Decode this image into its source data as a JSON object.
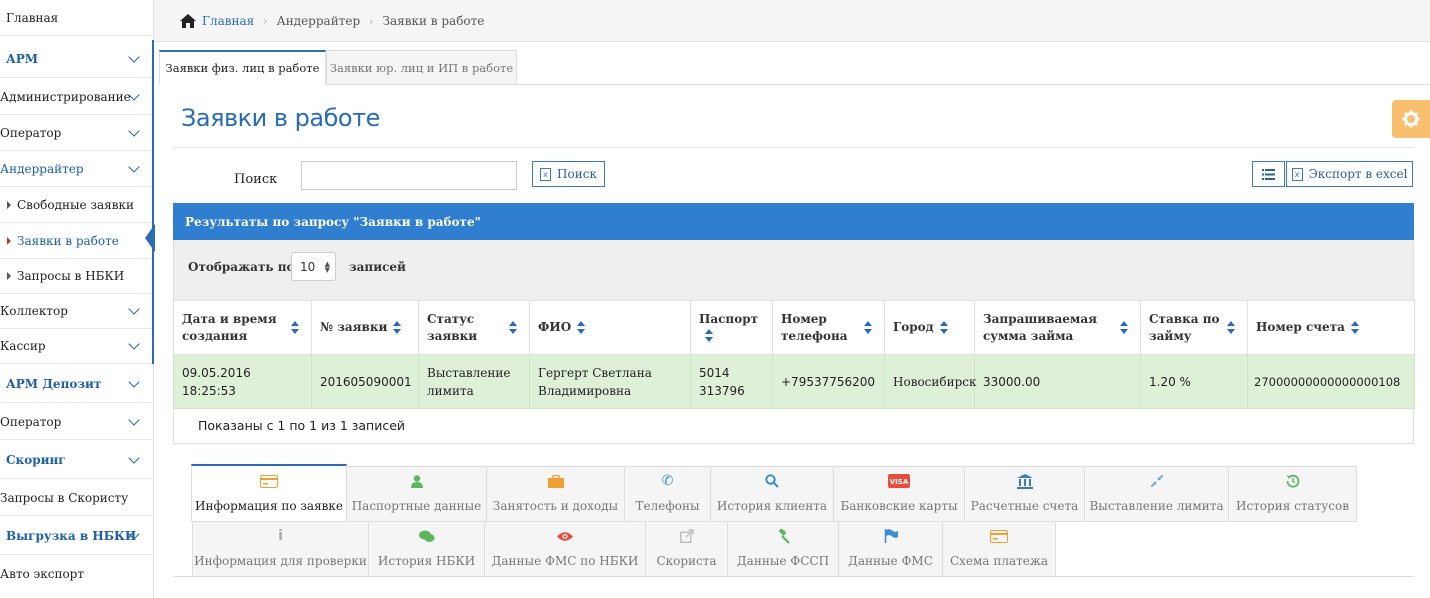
{
  "sidebar": {
    "home": "Главная",
    "arm": "АРМ",
    "administration": "Администрирование",
    "operator": "Оператор",
    "underwriter": "Андеррайтер",
    "free_requests": "Свободные заявки",
    "in_work": "Заявки в работе",
    "nbki_requests": "Запросы в НБКИ",
    "collector": "Коллектор",
    "cashier": "Кассир",
    "arm_deposit": "АРМ Депозит",
    "operator2": "Оператор",
    "scoring": "Скоринг",
    "scorista_requests": "Запросы в Скористу",
    "nbki_upload": "Выгрузка в НБКИ",
    "auto_export": "Авто экспорт"
  },
  "breadcrumb": {
    "home": "Главная",
    "section": "Андеррайтер",
    "current": "Заявки в работе"
  },
  "tabs": {
    "tab1": "Заявки физ. лиц в работе",
    "tab2": "Заявки юр. лиц и ИП в работе"
  },
  "page_title": "Заявки в работе",
  "search": {
    "label": "Поиск",
    "value": "",
    "button": "Поиск"
  },
  "export_button": "Экспорт в excel",
  "panel_title": "Результаты по запросу \"Заявки в работе\"",
  "page_size": {
    "prefix": "Отображать по",
    "value": "10",
    "suffix": "записей"
  },
  "table": {
    "headers": {
      "date": "Дата и время создания",
      "number": "№ заявки",
      "status": "Статус заявки",
      "fio": "ФИО",
      "passport": "Паспорт",
      "phone": "Номер телефона",
      "city": "Город",
      "amount": "Запрашиваемая сумма займа",
      "rate": "Ставка по займу",
      "account": "Номер счета"
    },
    "row": {
      "date": "09.05.2016 18:25:53",
      "number": "201605090001",
      "status": "Выставление лимита",
      "fio": "Гергерт Светлана Владимировна",
      "passport": "5014 313796",
      "phone": "+79537756200",
      "city": "Новосибирск",
      "amount": "33000.00",
      "rate": "1.20 %",
      "account": "27000000000000000108"
    }
  },
  "footer_info": "Показаны с 1 по 1 из 1 записей",
  "bottom_tabs": {
    "info": "Информация по заявке",
    "passport": "Паспортные данные",
    "employment": "Занятость и доходы",
    "phones": "Телефоны",
    "history": "История клиента",
    "cards": "Банковские карты",
    "accounts": "Расчетные счета",
    "limit": "Выставление лимита",
    "status_history": "История статусов",
    "check_info": "Информация для проверки",
    "nbki_history": "История НБКИ",
    "fms_nbki": "Данные ФМС по НБКИ",
    "scorista": "Скориста",
    "fssp": "Данные ФССП",
    "fms": "Данные ФМС",
    "payment_scheme": "Схема платежа"
  },
  "colors": {
    "accent": "#2f7ed0",
    "row_highlight": "#dff0d8",
    "gear": "#f8c06e"
  }
}
